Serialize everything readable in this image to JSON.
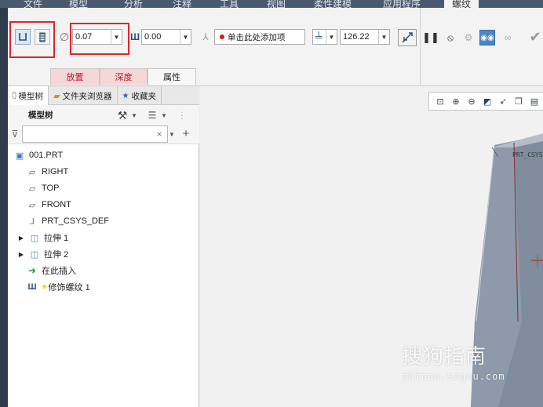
{
  "ribbon": {
    "tabs": [
      "文件",
      "模型",
      "分析",
      "注释",
      "工具",
      "视图",
      "柔性建模",
      "应用程序",
      "螺纹"
    ],
    "active_tab": "螺纹"
  },
  "dashboard": {
    "diameter_value": "0.07",
    "pitch_value": "0.00",
    "reference_placeholder": "单击此处添加项",
    "depth_value": "126.22",
    "subtabs": [
      "放置",
      "深度",
      "属性"
    ]
  },
  "panel": {
    "tabs": [
      "模型树",
      "文件夹浏览器",
      "收藏夹"
    ],
    "tree_title": "模型树",
    "filter_value": "",
    "nodes": [
      {
        "label": "001.PRT",
        "icon": "part-icon"
      },
      {
        "label": "RIGHT",
        "icon": "datum-plane-icon"
      },
      {
        "label": "TOP",
        "icon": "datum-plane-icon"
      },
      {
        "label": "FRONT",
        "icon": "datum-plane-icon"
      },
      {
        "label": "PRT_CSYS_DEF",
        "icon": "csys-icon"
      },
      {
        "label": "拉伸 1",
        "icon": "extrude-icon"
      },
      {
        "label": "拉伸 2",
        "icon": "extrude-icon"
      },
      {
        "label": "在此插入",
        "icon": "insert-arrow-icon"
      },
      {
        "label": "修饰螺纹 1",
        "icon": "cosmetic-thread-icon"
      }
    ]
  },
  "viewport": {
    "csys_label": "PRT_CSYS"
  },
  "watermark": {
    "main": "搜狗指南",
    "sub": "zhinan.sogou.com"
  },
  "colors": {
    "highlight_red": "#e0242b",
    "ribbon_dark": "#4a5a6e",
    "model_gray": "#7f8c9e"
  }
}
